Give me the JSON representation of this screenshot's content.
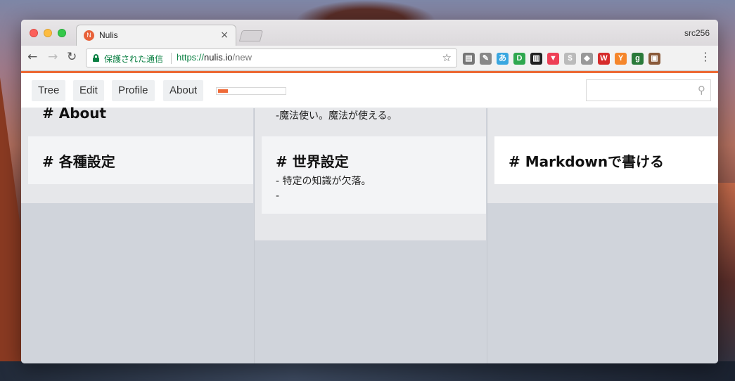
{
  "window": {
    "tab_title": "Nulis",
    "tab_favicon": "N",
    "tab_close": "×",
    "profile": "src256"
  },
  "toolbar": {
    "back": "←",
    "forward": "→",
    "reload": "↻",
    "secure_label": "保護された通信",
    "url_scheme": "https://",
    "url_host": "nulis.io",
    "url_path": "/new",
    "star": "☆",
    "menu": "⋮",
    "extensions": [
      {
        "name": "ext-page-icon",
        "glyph": "▤",
        "color": "#777777"
      },
      {
        "name": "ext-pin-icon",
        "glyph": "✎",
        "color": "#888888"
      },
      {
        "name": "ext-translate-icon",
        "glyph": "あ",
        "color": "#3aa7e0"
      },
      {
        "name": "ext-pushbullet-icon",
        "glyph": "D",
        "color": "#2fa84f"
      },
      {
        "name": "ext-archive-icon",
        "glyph": "▥",
        "color": "#222222"
      },
      {
        "name": "ext-pocket-icon",
        "glyph": "▼",
        "color": "#ee4056"
      },
      {
        "name": "ext-dollar-icon",
        "glyph": "$",
        "color": "#bbbbbb"
      },
      {
        "name": "ext-tag-icon",
        "glyph": "◆",
        "color": "#999999"
      },
      {
        "name": "ext-w-icon",
        "glyph": "W",
        "color": "#d62b2b"
      },
      {
        "name": "ext-y-icon",
        "glyph": "Y",
        "color": "#f5862b"
      },
      {
        "name": "ext-g-icon",
        "glyph": "g",
        "color": "#2a7a3a"
      },
      {
        "name": "ext-photo-icon",
        "glyph": "▣",
        "color": "#8a5a3a"
      }
    ]
  },
  "app": {
    "nav": {
      "tree": "Tree",
      "edit": "Edit",
      "profile": "Profile",
      "about": "About"
    },
    "progress": 0.15,
    "search_placeholder": "",
    "search_icon": "⚲"
  },
  "columns": {
    "col1": {
      "peek_title": "# About",
      "card_title": "# 各種設定"
    },
    "col2": {
      "peek_line": "-魔法使い。魔法が使える。",
      "card_title": "# 世界設定",
      "card_lines": [
        "- 特定の知識が欠落。",
        "-"
      ]
    },
    "col3": {
      "card_title": "# Markdownで書ける"
    }
  }
}
